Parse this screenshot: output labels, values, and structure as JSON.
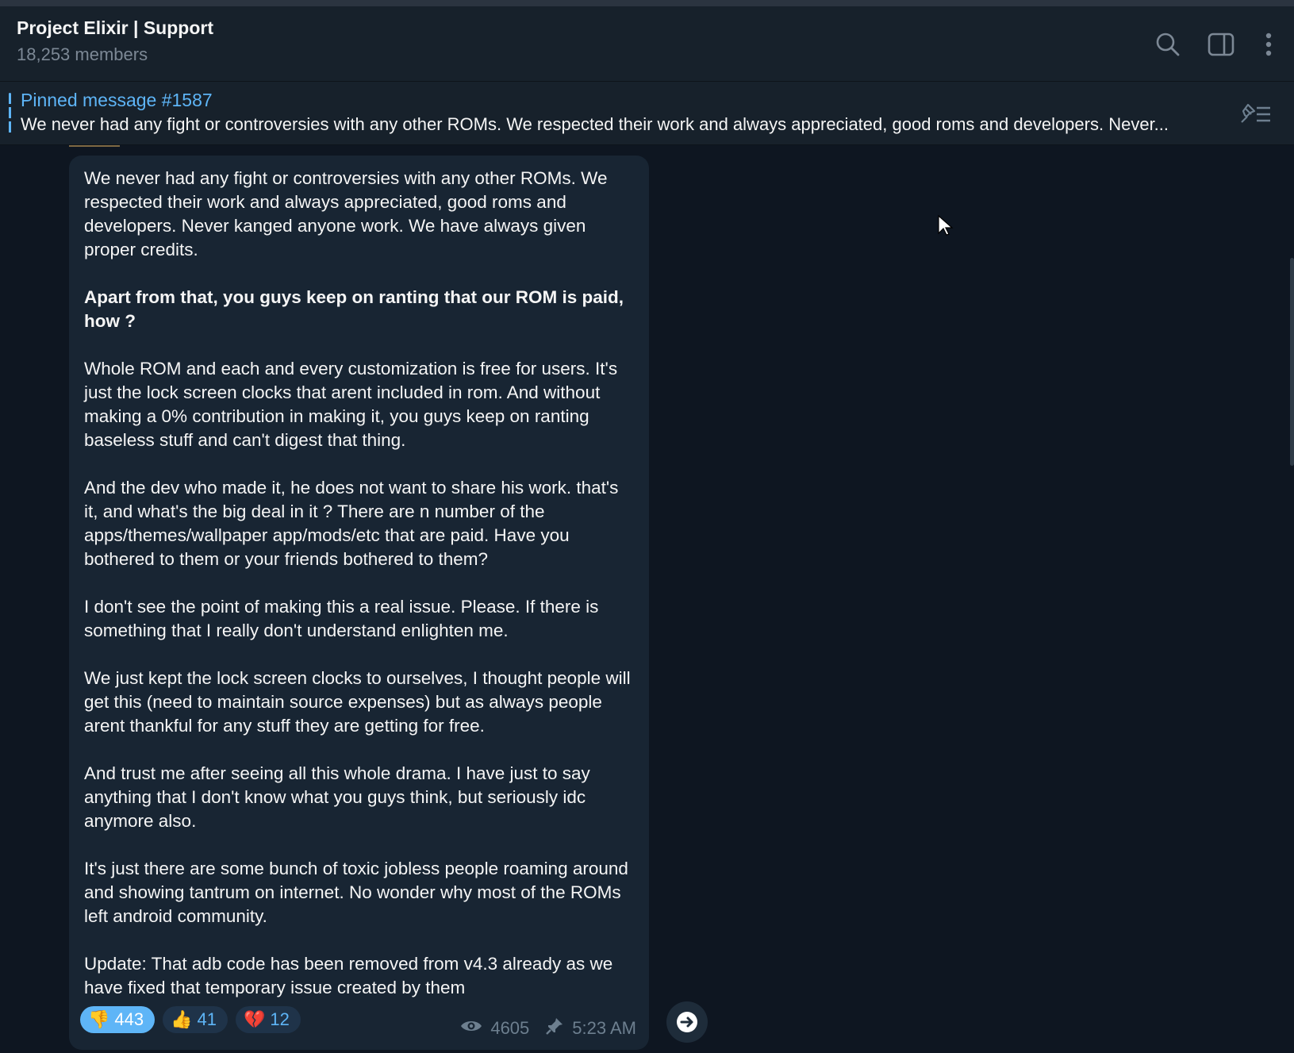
{
  "header": {
    "title": "Project Elixir | Support",
    "members": "18,253 members",
    "icons": [
      "search-icon",
      "sidebar-toggle-icon",
      "more-vertical-icon"
    ]
  },
  "pinned": {
    "title": "Pinned message #1587",
    "preview": "We never had any fight or controversies with any other ROMs. We respected their work and always appreciated, good roms and developers. Never..."
  },
  "message": {
    "paragraphs": [
      "We never had any fight or controversies with any other ROMs. We respected their work and always appreciated, good roms and developers. Never kanged anyone work. We have always given proper credits.",
      "Apart from that, you guys keep on ranting that our ROM is paid, how ?",
      "Whole ROM and each and every customization is free for users. It's just the lock screen clocks that arent included in rom. And without making a 0% contribution in making it, you guys keep on ranting baseless stuff and can't digest that thing.",
      "And the dev who made it, he does not want to share his work. that's it, and what's the big deal in it ? There are n number of the apps/themes/wallpaper app/mods/etc that are paid. Have you bothered to them or your friends bothered to them?",
      "I don't see the point of making this a real issue. Please. If there is something that I really don't understand enlighten me.",
      "We just kept the lock screen clocks to ourselves, I thought people will get this (need to maintain source expenses) but as always people arent thankful for any stuff they are getting for free.",
      "And trust me after seeing all this whole drama. I have just to say anything that I don't know what you guys think, but seriously idc anymore also.",
      "It's just there are some bunch of toxic jobless people roaming around and showing tantrum on internet. No wonder why most of the ROMs left android community.",
      "Update: That adb code has been removed from v4.3 already as we have fixed that temporary issue created by them"
    ],
    "reactions": [
      {
        "emoji": "👎",
        "count": "443"
      },
      {
        "emoji": "👍",
        "count": "41"
      },
      {
        "emoji": "💔",
        "count": "12"
      }
    ],
    "views": "4605",
    "time": "5:23 AM"
  },
  "colors": {
    "accent": "#5eb5f7",
    "background": "#0e1621",
    "bubble": "#182533",
    "header": "#17212b"
  }
}
